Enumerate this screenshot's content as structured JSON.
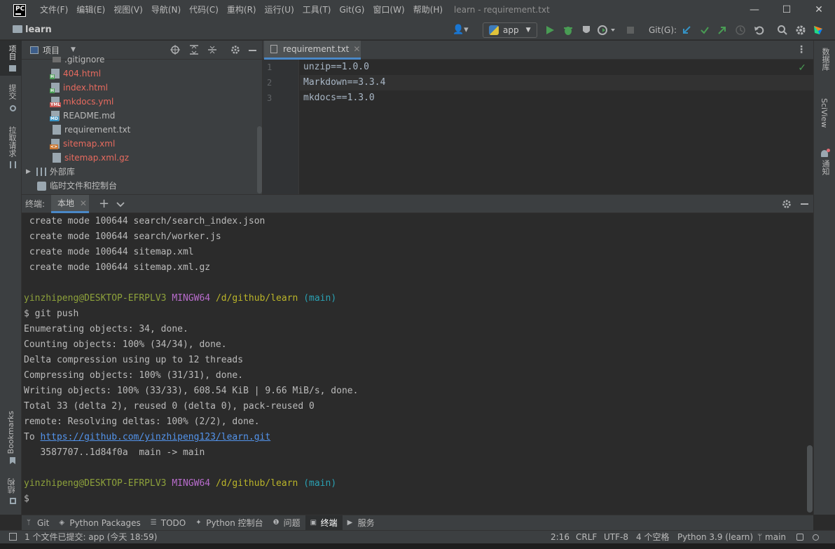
{
  "window": {
    "title": "learn - requirement.txt",
    "logo_text": "PC",
    "menu": [
      "文件(F)",
      "编辑(E)",
      "视图(V)",
      "导航(N)",
      "代码(C)",
      "重构(R)",
      "运行(U)",
      "工具(T)",
      "Git(G)",
      "窗口(W)",
      "帮助(H)"
    ],
    "minimize": "—",
    "maximize": "☐",
    "close": "✕"
  },
  "navbar": {
    "project": "learn",
    "run_config": "app",
    "git_label": "Git(G):"
  },
  "left_strip": {
    "project": "项目",
    "commit": "提交",
    "pull_requests": "拉取请求",
    "bookmarks": "Bookmarks",
    "structure": "结构"
  },
  "right_strip": {
    "database": "数据库",
    "sciview": "SciView",
    "notifications": "通知"
  },
  "project_panel": {
    "title": "项目",
    "items": [
      {
        "name": ".gitignore",
        "color": "grey",
        "tag": ""
      },
      {
        "name": "404.html",
        "color": "red",
        "tag": "H"
      },
      {
        "name": "index.html",
        "color": "red",
        "tag": "H"
      },
      {
        "name": "mkdocs.yml",
        "color": "red",
        "tag": "YML"
      },
      {
        "name": "README.md",
        "color": "grey",
        "tag": "MD"
      },
      {
        "name": "requirement.txt",
        "color": "grey",
        "tag": ""
      },
      {
        "name": "sitemap.xml",
        "color": "red",
        "tag": "<>"
      },
      {
        "name": "sitemap.xml.gz",
        "color": "red",
        "tag": ""
      }
    ],
    "external_libs": "外部库",
    "scratches": "临时文件和控制台"
  },
  "editor": {
    "tab": "requirement.txt",
    "lines": [
      {
        "num": "1",
        "text": "unzip==1.0.0"
      },
      {
        "num": "2",
        "text": "Markdown==3.3.4"
      },
      {
        "num": "3",
        "text": "mkdocs==1.3.0"
      }
    ]
  },
  "terminal": {
    "label": "终端:",
    "tab": "本地",
    "lines": [
      " create mode 100644 search/search_index.json",
      " create mode 100644 search/worker.js",
      " create mode 100644 sitemap.xml",
      " create mode 100644 sitemap.xml.gz",
      "",
      "",
      "$ git push",
      "Enumerating objects: 34, done.",
      "Counting objects: 100% (34/34), done.",
      "Delta compression using up to 12 threads",
      "Compressing objects: 100% (31/31), done.",
      "Writing objects: 100% (33/33), 608.54 KiB | 9.66 MiB/s, done.",
      "Total 33 (delta 2), reused 0 (delta 0), pack-reused 0",
      "remote: Resolving deltas: 100% (2/2), done.",
      "",
      "   3587707..1d84f0a  main -> main",
      "",
      "",
      "$"
    ],
    "prompt_user": "yinzhipeng@DESKTOP-EFRPLV3",
    "prompt_env": "MINGW64",
    "prompt_path": "/d/github/learn",
    "prompt_branch": "(main)",
    "to_label": "To ",
    "push_url": "https://github.com/yinzhipeng123/learn.git"
  },
  "toolwindows": [
    {
      "label": "Git",
      "icon": "git-icon"
    },
    {
      "label": "Python Packages",
      "icon": "packages-icon"
    },
    {
      "label": "TODO",
      "icon": "todo-icon"
    },
    {
      "label": "Python 控制台",
      "icon": "python-console-icon"
    },
    {
      "label": "问题",
      "icon": "problems-icon"
    },
    {
      "label": "终端",
      "icon": "terminal-icon"
    },
    {
      "label": "服务",
      "icon": "services-icon"
    }
  ],
  "status": {
    "message": "1 个文件已提交: app (今天 18:59)",
    "position": "2:16",
    "line_ending": "CRLF",
    "encoding": "UTF-8",
    "indent": "4 个空格",
    "interpreter": "Python 3.9 (learn)",
    "branch": "main"
  }
}
